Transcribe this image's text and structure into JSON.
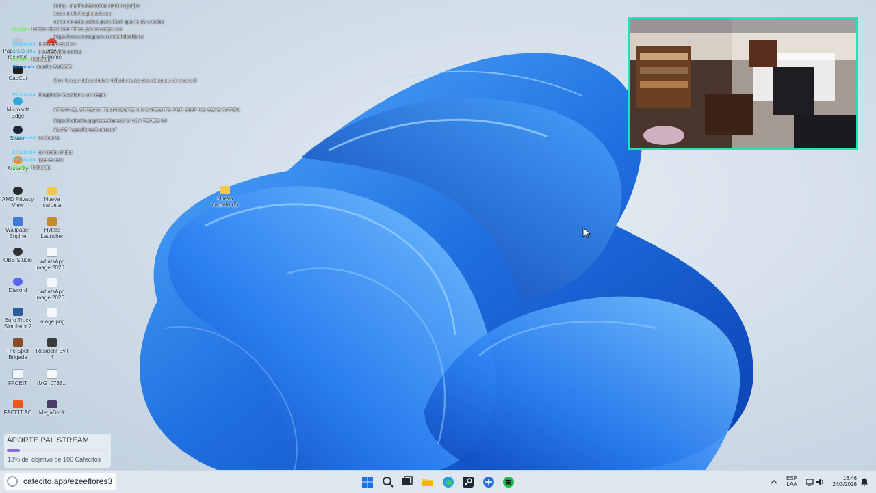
{
  "desktop_icons": [
    {
      "label": "Papelera de reciclaje"
    },
    {
      "label": "Google Chrome"
    },
    {
      "label": "CapCut"
    },
    {
      "label": "Microsoft Edge"
    },
    {
      "label": "Steam"
    },
    {
      "label": "Audacity"
    },
    {
      "label": "AMD Privacy View"
    },
    {
      "label": "Nueva carpeta"
    },
    {
      "label": "Wallpaper Engine"
    },
    {
      "label": "Hytale Launcher"
    },
    {
      "label": "OBS Studio"
    },
    {
      "label": "WhatsApp Image 2026..."
    },
    {
      "label": "Discord"
    },
    {
      "label": "WhatsApp Image 2026..."
    },
    {
      "label": "Euro Truck Simulator 2"
    },
    {
      "label": "image.png"
    },
    {
      "label": "The Spell Brigade"
    },
    {
      "label": "Resident Evil 4"
    },
    {
      "label": "FACEIT"
    },
    {
      "label": "IMG_0738..."
    },
    {
      "label": "FACEIT AC"
    },
    {
      "label": "MegaBonk"
    },
    {
      "label": "Nueva carpeta (2)"
    }
  ],
  "chat": [
    {
      "user": "",
      "msg": "rocky . medio Maradona todo kajsdjks",
      "color": "#ffffff"
    },
    {
      "user": "",
      "msg": "esta medio hugh jackman",
      "color": "#ffffff"
    },
    {
      "user": "",
      "msg": "como no esta sativa para decir que le da a todos",
      "color": "#ffffff"
    },
    {
      "user": "BorBix",
      "msg": "Podes chusmear libros por encargo aca",
      "color": "#7cf06a"
    },
    {
      "user": "",
      "msg": "https://www.instagram.com/elfulbollbros",
      "color": "#ffffff"
    },
    {
      "user": "ElCabe04",
      "msg": "la tendra el pito?",
      "color": "#62d3ff"
    },
    {
      "user": "ElCabe04",
      "msg": "o serian pito cortos",
      "color": "#62d3ff"
    },
    {
      "user": "BorBix",
      "msg": "hola jaja",
      "color": "#7cf06a"
    },
    {
      "user": "Shamiah",
      "msg": "mucho SUDOR",
      "color": "#2f8cff"
    },
    {
      "user": "",
      "msg": "Orrrr lo que deben haber follado estos dos despues de esa peli",
      "color": "#ffffff"
    },
    {
      "user": "ElCabe04",
      "msg": "imaginate levantar a un negro",
      "color": "#62d3ff"
    },
    {
      "user": "",
      "msg": "APOYA EL STREAM TOMANDOTE UN CAFECITO POR 300P NO SEAS RATON",
      "color": "#ffffff"
    },
    {
      "user": "",
      "msg": "https://cafecito.app/ezeeflores3 O ACA TENES MI",
      "color": "#ffffff"
    },
    {
      "user": "",
      "msg": "ALIAS \"ezeeflores3.stream\"",
      "color": "#ffffff"
    },
    {
      "user": "ElCabe04",
      "msg": "na buena",
      "color": "#62d3ff"
    },
    {
      "user": "ElCabe04",
      "msg": "se venia el tipo",
      "color": "#62d3ff"
    },
    {
      "user": "ElCabe04",
      "msg": "que es eso",
      "color": "#62d3ff"
    },
    {
      "user": "BorBix",
      "msg": "hola jaja",
      "color": "#7cf06a"
    }
  ],
  "donation": {
    "title": "APORTE PAL STREAM",
    "progress_percent": 13,
    "subtitle": "13% del objetivo de 100 Cafecitos"
  },
  "taskbar": {
    "url": "cafecito.app/ezeeflores3",
    "apps": [
      "start-icon",
      "search-icon",
      "task-view-icon",
      "file-explorer-icon",
      "edge-icon",
      "steam-icon",
      "browser-icon",
      "spotify-icon"
    ],
    "language": "ESP",
    "language_sub": "LAA",
    "time": "16:46",
    "date": "24/3/2026"
  },
  "colors": {
    "webcam_border": "#19e7b8",
    "donation_fill": "#8a6be0",
    "wallpaper_blue": "#1f6fe0"
  }
}
